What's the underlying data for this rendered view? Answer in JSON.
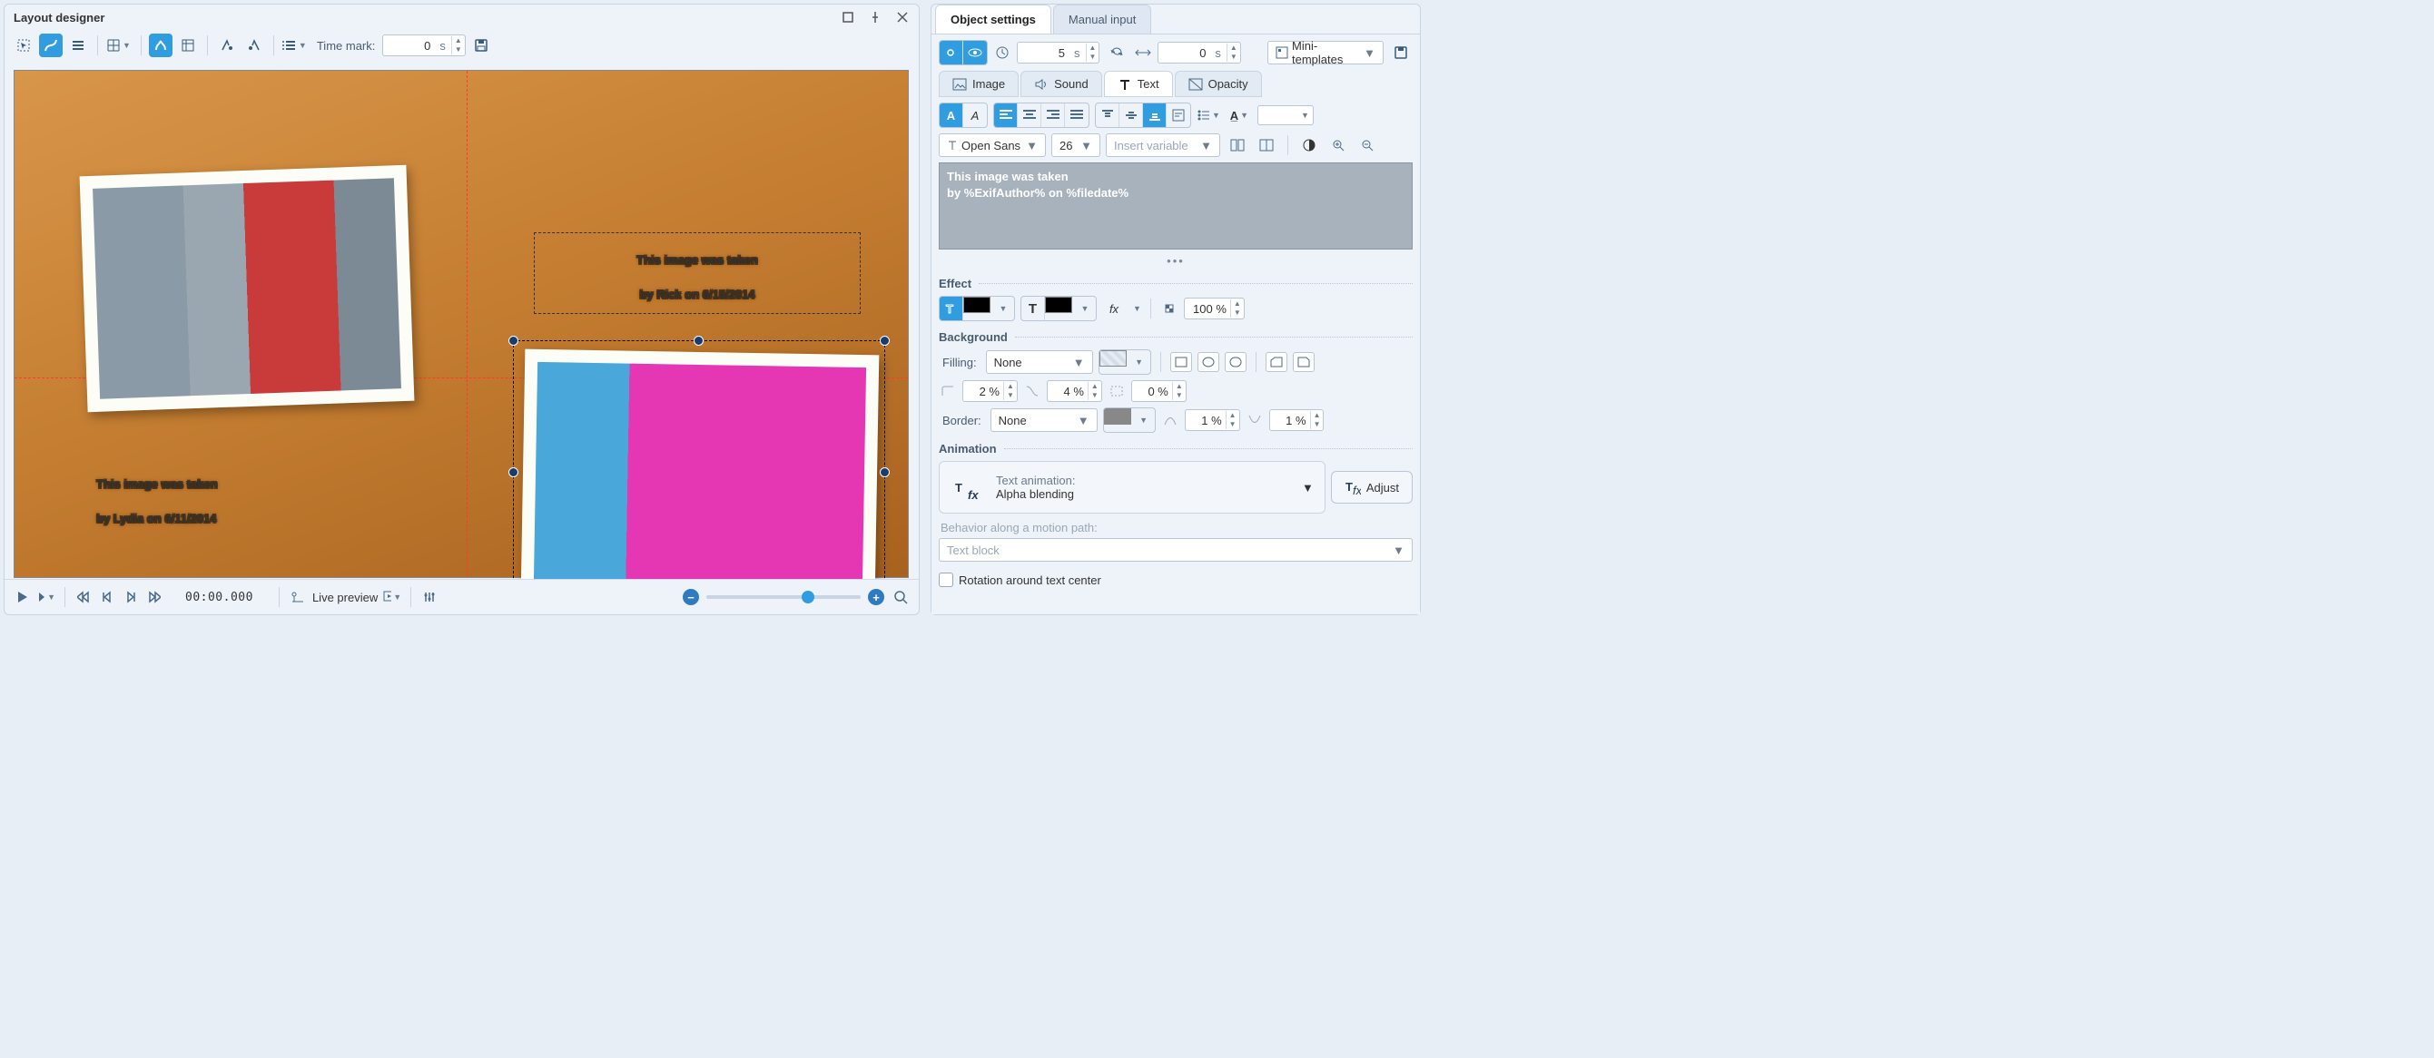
{
  "window": {
    "title": "Layout designer"
  },
  "toolbar": {
    "time_mark_label": "Time mark:",
    "time_mark_value": "0",
    "time_mark_unit": "s"
  },
  "canvas": {
    "caption1": "This image was taken\nby Lydia on 6/11/2014",
    "caption2": "This image was taken\nby Rick on 6/15/2014"
  },
  "playbar": {
    "timecode": "00:00.000",
    "live_preview": "Live preview"
  },
  "tabs": {
    "object": "Object settings",
    "manual": "Manual input"
  },
  "timing": {
    "duration_value": "5",
    "duration_unit": "s",
    "offset_value": "0",
    "offset_unit": "s",
    "mini_templates": "Mini-templates"
  },
  "sub_tabs": {
    "image": "Image",
    "sound": "Sound",
    "text": "Text",
    "opacity": "Opacity"
  },
  "font": {
    "family": "Open Sans",
    "size": "26",
    "variable_placeholder": "Insert variable"
  },
  "text_content": "This image was taken\nby %ExifAuthor% on %filedate%",
  "sections": {
    "effect": "Effect",
    "background": "Background",
    "animation": "Animation"
  },
  "effect": {
    "opacity": "100 %"
  },
  "background": {
    "filling_label": "Filling:",
    "filling_value": "None",
    "border_label": "Border:",
    "border_value": "None",
    "radius_x": "2 %",
    "radius_y": "4 %",
    "extra_pct": "0 %",
    "border_w1": "1 %",
    "border_w2": "1 %"
  },
  "animation": {
    "label": "Text animation:",
    "value": "Alpha blending",
    "adjust": "Adjust",
    "behavior_label": "Behavior along a motion path:",
    "behavior_value": "Text block",
    "rotation": "Rotation around text center"
  }
}
